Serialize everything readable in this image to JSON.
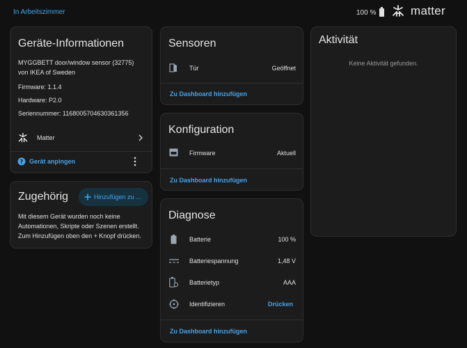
{
  "header": {
    "breadcrumb": "In Arbeitszimmer",
    "battery": "100 %",
    "brand": "matter"
  },
  "device_info": {
    "title": "Geräte-Informationen",
    "model_line1": "MYGGBETT door/window sensor (32775)",
    "model_line2": "von IKEA of Sweden",
    "firmware": "Firmware: 1.1.4",
    "hardware": "Hardware: P2.0",
    "serial": "Seriennummer: 1168005704630361356",
    "integration": "Matter",
    "ping_label": "Gerät anpingen"
  },
  "related": {
    "title": "Zugehörig",
    "add_button": "Hinzufügen zu ...",
    "text_line1": "Mit diesem Gerät wurden noch keine",
    "text_line2": "Automationen, Skripte oder Szenen erstellt.",
    "text_line3": "Zum Hinzufügen oben den + Knopf drücken."
  },
  "sensors": {
    "title": "Sensoren",
    "rows": [
      {
        "label": "Tür",
        "value": "Geöffnet",
        "icon": "door-open-icon"
      }
    ],
    "add_link": "Zu Dashboard hinzufügen"
  },
  "config": {
    "title": "Konfiguration",
    "rows": [
      {
        "label": "Firmware",
        "value": "Aktuell",
        "icon": "firmware-icon"
      }
    ],
    "add_link": "Zu Dashboard hinzufügen"
  },
  "diagnostics": {
    "title": "Diagnose",
    "rows": [
      {
        "label": "Batterie",
        "value": "100 %",
        "icon": "battery-icon"
      },
      {
        "label": "Batteriespannung",
        "value": "1,48 V",
        "icon": "voltage-icon"
      },
      {
        "label": "Batterietyp",
        "value": "AAA",
        "icon": "battery-type-icon"
      },
      {
        "label": "Identifizieren",
        "value": "Drücken",
        "icon": "identify-icon"
      }
    ],
    "add_link": "Zu Dashboard hinzufügen"
  },
  "activity": {
    "title": "Aktivität",
    "empty": "Keine Aktivität gefunden."
  },
  "colors": {
    "background": "#111111",
    "card": "#1c1c1c",
    "accent": "#4aa3e6",
    "text": "#e1e1e1"
  }
}
